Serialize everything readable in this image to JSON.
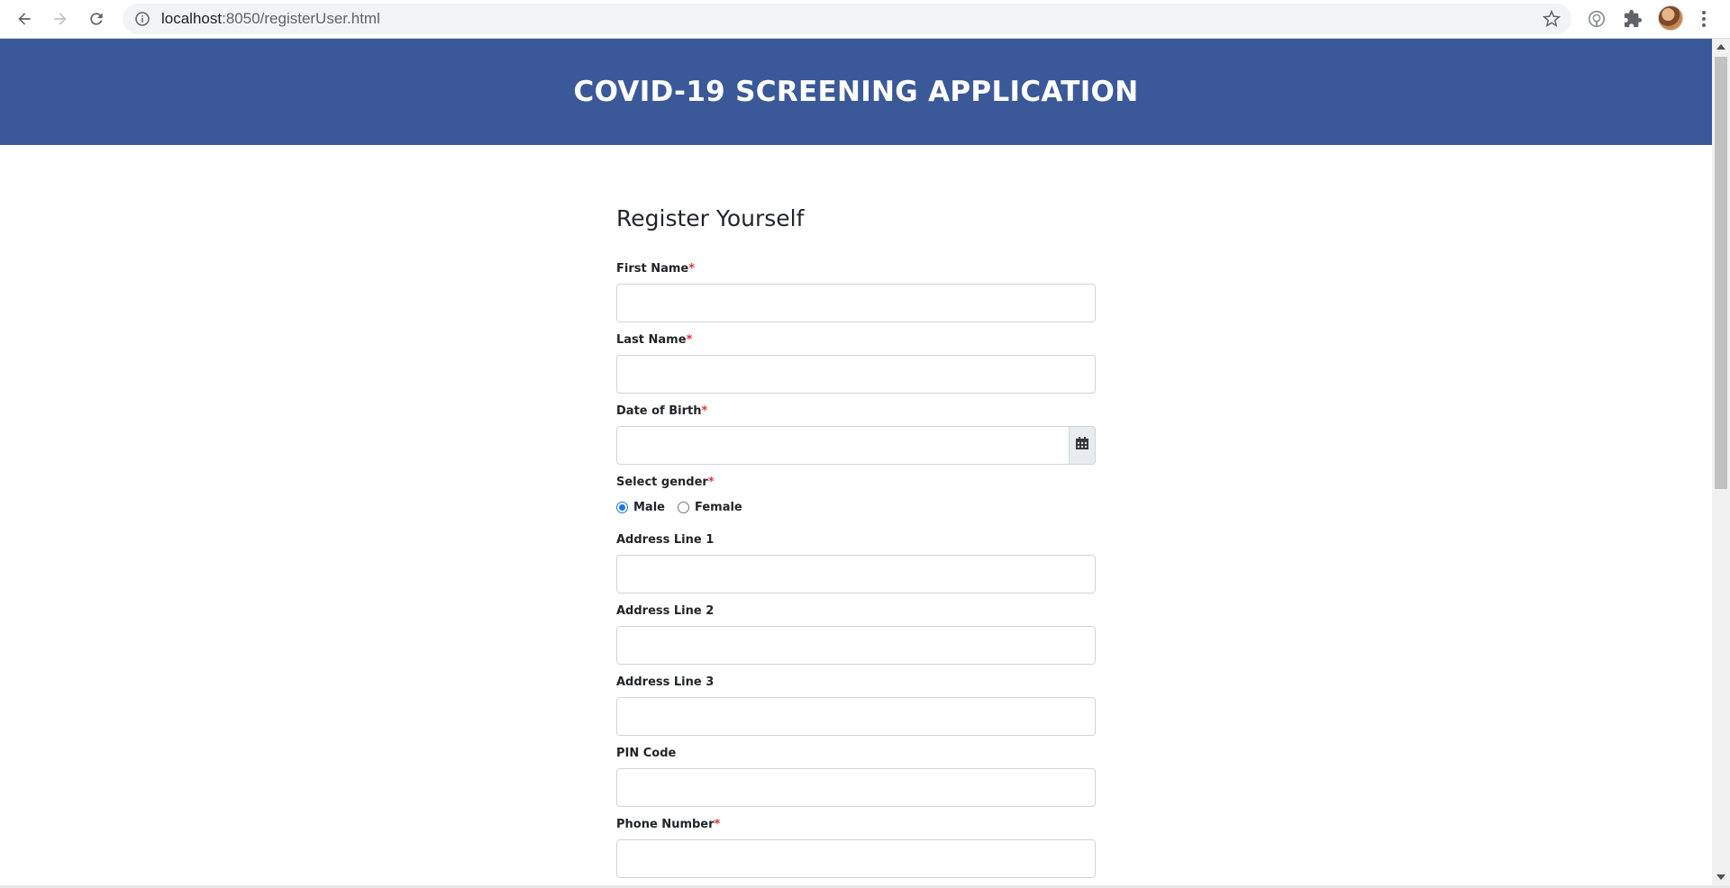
{
  "browser": {
    "url_host": "localhost",
    "url_port_path": ":8050/registerUser.html",
    "icons": [
      "back-arrow-icon",
      "forward-arrow-icon",
      "reload-icon",
      "info-icon",
      "star-icon",
      "podcast-icon",
      "puzzle-icon",
      "kebab-menu-icon"
    ]
  },
  "header": {
    "title": "COVID-19 SCREENING APPLICATION",
    "bg_color": "#3b5998"
  },
  "form": {
    "title": "Register Yourself",
    "required_marker": "*",
    "required_color": "#dc3545",
    "fields": {
      "first_name": {
        "label": "First Name",
        "value": ""
      },
      "last_name": {
        "label": "Last Name",
        "value": ""
      },
      "dob": {
        "label": "Date of Birth",
        "value": ""
      },
      "gender": {
        "label": "Select gender",
        "options": [
          "Male",
          "Female"
        ],
        "selected": "Male"
      },
      "address1": {
        "label": "Address Line 1",
        "value": ""
      },
      "address2": {
        "label": "Address Line 2",
        "value": ""
      },
      "address3": {
        "label": "Address Line 3",
        "value": ""
      },
      "pin": {
        "label": "PIN Code",
        "value": ""
      },
      "phone": {
        "label": "Phone Number",
        "value": ""
      }
    }
  }
}
